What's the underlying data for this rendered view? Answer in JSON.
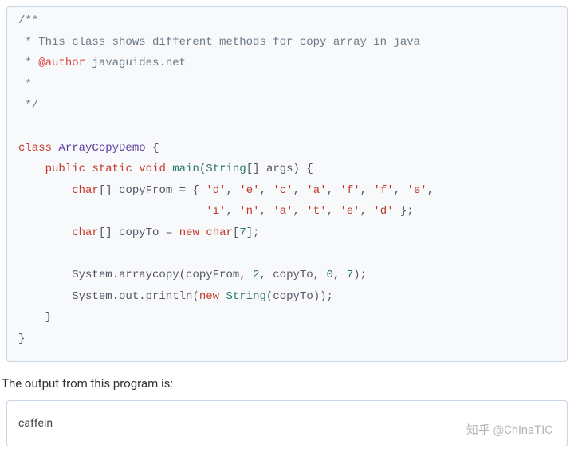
{
  "code": {
    "c1": "/**",
    "c2": " * This class shows different methods for copy array in java",
    "c3_pre": " * ",
    "c3_tag": "@author",
    "c3_post": " javaguides.net",
    "c4": " *",
    "c5": " */",
    "kw_class": "class",
    "class_name": "ArrayCopyDemo",
    "brace_open": " {",
    "kw_public": "public",
    "kw_static": "static",
    "kw_void": "void",
    "m_main": "main",
    "paren_open": "(",
    "t_string": "String",
    "arr_brackets": "[] ",
    "p_args": "args",
    "paren_close_brace": ") {",
    "t_char": "char",
    "arr_br2": "[] ",
    "v_copyFrom": "copyFrom",
    "eq": " = ",
    "arr_open": "{ ",
    "s_d": "'d'",
    "s_e": "'e'",
    "s_c": "'c'",
    "s_a": "'a'",
    "s_f": "'f'",
    "s_i": "'i'",
    "s_n": "'n'",
    "s_t": "'t'",
    "comma": ", ",
    "arr_close": " };",
    "v_copyTo": "copyTo",
    "kw_new": "new",
    "n_7": "7",
    "semi": ";",
    "brack_open": "[",
    "brack_close": "]",
    "sys_arraycopy_pre": "System.arraycopy(copyFrom, ",
    "n_2": "2",
    "mid1": ", copyTo, ",
    "n_0": "0",
    "mid2": ", ",
    "end_paren": ");",
    "sys_println_pre": "System.out.println(",
    "string_ctor": "String",
    "in_copyTo": "(copyTo));",
    "brace_close": "}",
    "indent1": "    ",
    "indent2": "        ",
    "indent_arr2": "                            "
  },
  "desc": "The output from this program is:",
  "output": "caffein",
  "watermark": "知乎 @ChinaTIC"
}
